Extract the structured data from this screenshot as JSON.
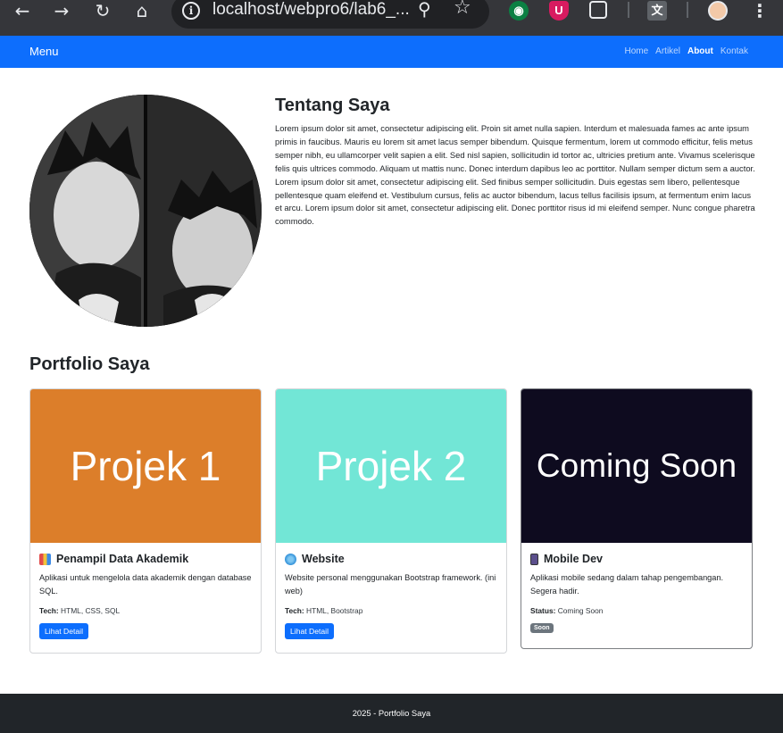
{
  "browser": {
    "url": "localhost/webpro6/lab6_...",
    "extension_u_label": "U"
  },
  "navbar": {
    "brand": "Menu",
    "links": [
      {
        "label": "Home",
        "active": false
      },
      {
        "label": "Artikel",
        "active": false
      },
      {
        "label": "About",
        "active": true
      },
      {
        "label": "Kontak",
        "active": false
      }
    ]
  },
  "about": {
    "title": "Tentang Saya",
    "text": "Lorem ipsum dolor sit amet, consectetur adipiscing elit. Proin sit amet nulla sapien. Interdum et malesuada fames ac ante ipsum primis in faucibus. Mauris eu lorem sit amet lacus semper bibendum. Quisque fermentum, lorem ut commodo efficitur, felis metus semper nibh, eu ullamcorper velit sapien a elit. Sed nisl sapien, sollicitudin id tortor ac, ultricies pretium ante. Vivamus scelerisque felis quis ultrices commodo. Aliquam ut mattis nunc. Donec interdum dapibus leo ac porttitor. Nullam semper dictum sem a auctor. Lorem ipsum dolor sit amet, consectetur adipiscing elit. Sed finibus semper sollicitudin. Duis egestas sem libero, pellentesque pellentesque quam eleifend et. Vestibulum cursus, felis ac auctor bibendum, lacus tellus facilisis ipsum, at fermentum enim lacus et arcu. Lorem ipsum dolor sit amet, consectetur adipiscing elit. Donec porttitor risus id mi eleifend semper. Nunc congue pharetra commodo."
  },
  "portfolio": {
    "title": "Portfolio Saya",
    "cards": [
      {
        "thumb_text": "Projek 1",
        "thumb_color": "#dc7e2a",
        "icon": "bar-chart-icon",
        "title": "Penampil Data Akademik",
        "description": "Aplikasi untuk mengelola data akademik dengan database SQL.",
        "meta_label": "Tech:",
        "meta_value": "HTML, CSS, SQL",
        "action": "Lihat Detail"
      },
      {
        "thumb_text": "Projek 2",
        "thumb_color": "#72e6d6",
        "icon": "globe-icon",
        "title": "Website",
        "description": "Website personal menggunakan Bootstrap framework. (ini web)",
        "meta_label": "Tech:",
        "meta_value": "HTML, Bootstrap",
        "action": "Lihat Detail"
      },
      {
        "thumb_text": "Coming Soon",
        "thumb_color": "#0e0b1f",
        "icon": "mobile-phone-icon",
        "title": "Mobile Dev",
        "description": "Aplikasi mobile sedang dalam tahap pengembangan. Segera hadir.",
        "meta_label": "Status:",
        "meta_value": "Coming Soon",
        "badge": "Soon"
      }
    ]
  },
  "footer": {
    "text": "2025 - Portfolio Saya"
  }
}
